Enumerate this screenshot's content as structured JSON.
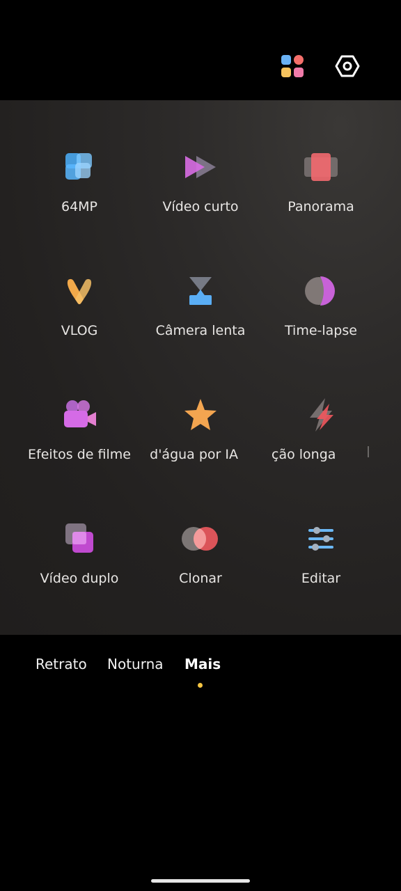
{
  "modes": [
    {
      "label": "64MP",
      "icon": "grid-64mp-icon"
    },
    {
      "label": "Vídeo curto",
      "icon": "short-video-icon"
    },
    {
      "label": "Panorama",
      "icon": "panorama-icon"
    },
    {
      "label": "VLOG",
      "icon": "vlog-icon"
    },
    {
      "label": "Câmera lenta",
      "icon": "slow-motion-icon"
    },
    {
      "label": "Time-lapse",
      "icon": "time-lapse-icon"
    },
    {
      "label": "Efeitos de filme",
      "icon": "film-camera-icon"
    },
    {
      "label": "d'água por IA",
      "icon": "star-icon"
    },
    {
      "label": "ção longa",
      "icon": "lightning-icon"
    },
    {
      "label": "Vídeo duplo",
      "icon": "dual-video-icon"
    },
    {
      "label": "Clonar",
      "icon": "clone-icon"
    },
    {
      "label": "Editar",
      "icon": "edit-sliders-icon"
    }
  ],
  "tabs": [
    "Retrato",
    "Noturna",
    "Mais"
  ],
  "active_tab": "Mais",
  "accent_color": "#f5c542"
}
